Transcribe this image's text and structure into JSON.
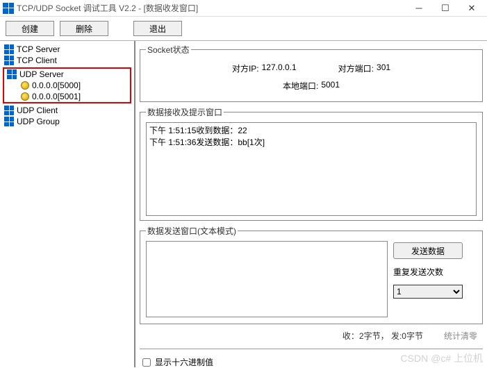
{
  "window": {
    "title": "TCP/UDP Socket 调试工具 V2.2 - [数据收发窗口]"
  },
  "toolbar": {
    "create": "创建",
    "delete": "删除",
    "exit": "退出"
  },
  "tree": {
    "tcp_server": "TCP Server",
    "tcp_client": "TCP Client",
    "udp_server": "UDP Server",
    "udp_conn1": "0.0.0.0[5000]",
    "udp_conn2": "0.0.0.0[5001]",
    "udp_client": "UDP Client",
    "udp_group": "UDP Group"
  },
  "socket_status": {
    "legend": "Socket状态",
    "peer_ip_label": "对方IP:",
    "peer_ip": "127.0.0.1",
    "peer_port_label": "对方端口:",
    "peer_port": "301",
    "local_port_label": "本地端口:",
    "local_port": "5001"
  },
  "recv": {
    "legend": "数据接收及提示窗口",
    "log": "下午 1:51:15收到数据：22\n下午 1:51:36发送数据：bb[1次]"
  },
  "send": {
    "legend": "数据发送窗口(文本模式)",
    "send_btn": "发送数据",
    "repeat_label": "重复发送次数",
    "repeat_value": "1"
  },
  "stats": {
    "recv_label": "收：",
    "recv_value": "2字节，",
    "send_label": "发:",
    "send_value": "0字节",
    "reset": "统计清零"
  },
  "hex": {
    "label": "显示十六进制值"
  },
  "watermark": "CSDN @c# 上位机"
}
